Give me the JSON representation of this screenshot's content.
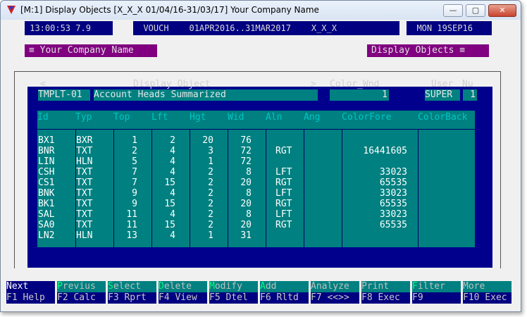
{
  "window": {
    "title": "[M:1]  Display Objects  [X_X_X  01/04/16-31/03/17]  Your Company Name",
    "min_glyph": "—",
    "max_glyph": "▢",
    "close_glyph": "✕"
  },
  "status": {
    "time": " 13:00:53 7.9 ",
    "voucher": "  VOUCH    01APR2016..31MAR2017    X_X_X ",
    "date": "  MON 19SEP16 "
  },
  "captions": {
    "left": "≡ Your Company Name",
    "right": "Display Objects ≡"
  },
  "form": {
    "prev_arrow": "<",
    "object_label": "Display Object",
    "next_arrow": ">",
    "color_wnd_label": "Color_Wnd",
    "user_label": "User",
    "nu_label": "Nu",
    "template_code": "TMPLT-01",
    "template_name": "Account Heads Summarized",
    "color_wnd_value": "1",
    "user_value": "SUPER",
    "nu_value": "1"
  },
  "table": {
    "columns": [
      "Id",
      "Typ",
      "Top",
      "Lft",
      "Hgt",
      "Wid",
      "Aln",
      "Ang",
      "ColorFore",
      "ColorBack"
    ],
    "rows": [
      [
        "BX1",
        "BXR",
        "1",
        "2",
        "20",
        "76",
        "",
        "",
        "",
        ""
      ],
      [
        "BNR",
        "TXT",
        "2",
        "4",
        "3",
        "72",
        "RGT",
        "",
        "16441605",
        ""
      ],
      [
        "LIN",
        "HLN",
        "5",
        "4",
        "1",
        "72",
        "",
        "",
        "",
        ""
      ],
      [
        "CSH",
        "TXT",
        "7",
        "4",
        "2",
        "8",
        "LFT",
        "",
        "33023",
        ""
      ],
      [
        "CS1",
        "TXT",
        "7",
        "15",
        "2",
        "20",
        "RGT",
        "",
        "65535",
        ""
      ],
      [
        "BNK",
        "TXT",
        "9",
        "4",
        "2",
        "8",
        "LFT",
        "",
        "33023",
        ""
      ],
      [
        "BK1",
        "TXT",
        "9",
        "15",
        "2",
        "20",
        "RGT",
        "",
        "65535",
        ""
      ],
      [
        "SAL",
        "TXT",
        "11",
        "4",
        "2",
        "8",
        "LFT",
        "",
        "33023",
        ""
      ],
      [
        "SA0",
        "TXT",
        "11",
        "15",
        "2",
        "20",
        "RGT",
        "",
        "65535",
        ""
      ],
      [
        "LN2",
        "HLN",
        "13",
        "4",
        "1",
        "31",
        "",
        "",
        "",
        ""
      ]
    ]
  },
  "fkeys": [
    {
      "top_hot": "",
      "top_rest": "Next",
      "bottom": "F1 Help"
    },
    {
      "top_hot": "P",
      "top_rest": "revius",
      "bottom": "F2 Calc"
    },
    {
      "top_hot": "S",
      "top_rest": "elect",
      "bottom": "F3 Rprt"
    },
    {
      "top_hot": "D",
      "top_rest": "elete",
      "bottom": "F4 View"
    },
    {
      "top_hot": "M",
      "top_rest": "odify",
      "bottom": "F5 Dtel"
    },
    {
      "top_hot": "A",
      "top_rest": "dd",
      "bottom": "F6 Rltd"
    },
    {
      "top_hot": "",
      "top_rest": "Analyze",
      "bottom": "F7 <<>>"
    },
    {
      "top_hot": "",
      "top_rest": "Print",
      "bottom": "F8 Exec"
    },
    {
      "top_hot": "F",
      "top_rest": "ilter",
      "bottom": "F9"
    },
    {
      "top_hot": "",
      "top_rest": "More",
      "bottom": "F10 Exec"
    }
  ]
}
